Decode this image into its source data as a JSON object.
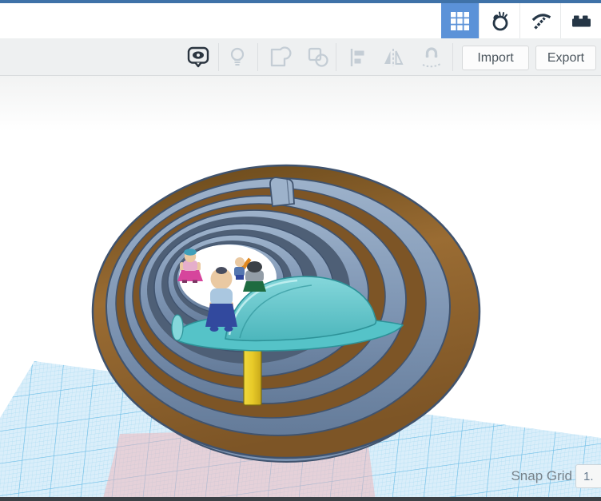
{
  "topbar": {
    "modes": [
      {
        "icon": "grid-icon",
        "active": true
      },
      {
        "icon": "bouncing-ball-icon",
        "active": false
      },
      {
        "icon": "pickaxe-icon",
        "active": false
      },
      {
        "icon": "brick-icon",
        "active": false
      }
    ]
  },
  "toolbar": {
    "tools": [
      {
        "icon": "eye-bubble-icon",
        "state": "active"
      },
      {
        "icon": "lightbulb-icon",
        "state": "disabled"
      },
      {
        "icon": "group-icon",
        "state": "disabled"
      },
      {
        "icon": "ungroup-icon",
        "state": "disabled"
      },
      {
        "icon": "align-icon",
        "state": "disabled"
      },
      {
        "icon": "mirror-icon",
        "state": "disabled"
      },
      {
        "icon": "magnet-icon",
        "state": "disabled"
      }
    ],
    "import_label": "Import",
    "export_label": "Export"
  },
  "statusbar": {
    "snap_grid_label": "Snap Grid",
    "snap_grid_value": "1."
  },
  "colors": {
    "top_strip": "#3f72a8",
    "accent_blue": "#5b92d8",
    "header_bg": "#ffffff",
    "mode_icon": "#253646",
    "toolbar_bg": "#eef0f1",
    "toolbar_border": "#d9dcde",
    "tool_active": "#2b3540",
    "tool_disabled": "#c4cdd5",
    "button_bg": "#fcfcfc",
    "button_border": "#d7d9da",
    "button_text": "#4c565e",
    "viewport_bg_top": "#f2f3f3",
    "viewport_bg": "#ffffff",
    "grid_base": "#daeefa",
    "grid_fine": "#aadcf2",
    "grid_major": "#6cbde6",
    "shadow_pink": "#f0b4b8",
    "status_text": "#77828a",
    "dropdown_bg": "#f6f7f7",
    "dropdown_border": "#ccd4da",
    "dropdown_text": "#64788c",
    "bottom_bar": "#3c4146",
    "spiral_brown_dark": "#654619",
    "spiral_brown": "#9a6c33",
    "spiral_brown_low": "#7d5526",
    "spiral_outline": "#40536e",
    "coil_light": "#9db2cb",
    "coil_mid": "#7e95b3",
    "coil_dark": "#647b99",
    "coil_gap_dark": "#4e5f76",
    "hole_white": "#ffffff",
    "platform_teal": "#55c3c8",
    "dome_teal_light": "#85d7db",
    "dome_teal": "#4cb6bc",
    "teal_edge": "#2d9298",
    "teal_highlight": "#c2eff1",
    "pole_yellow": "#e7ca28",
    "pole_shade": "#c8a81a",
    "skin": "#eac9a2",
    "fig_shirt_blue": "#aac7e0",
    "fig_skirt_navy": "#32499e",
    "fig_hair_dark": "#474c5e",
    "fig_hair_black": "#3b4046",
    "fig_hat_teal": "#3f9fba",
    "fig_top_pink": "#e5aecb",
    "fig_skirt_pink": "#d6459c",
    "fig_shoe_plum": "#7a3562",
    "fig_arm_orange": "#e08820",
    "fig_body_blue": "#5577b0",
    "fig_shirt_gray": "#939da7",
    "fig_base_green": "#1e6b40"
  }
}
